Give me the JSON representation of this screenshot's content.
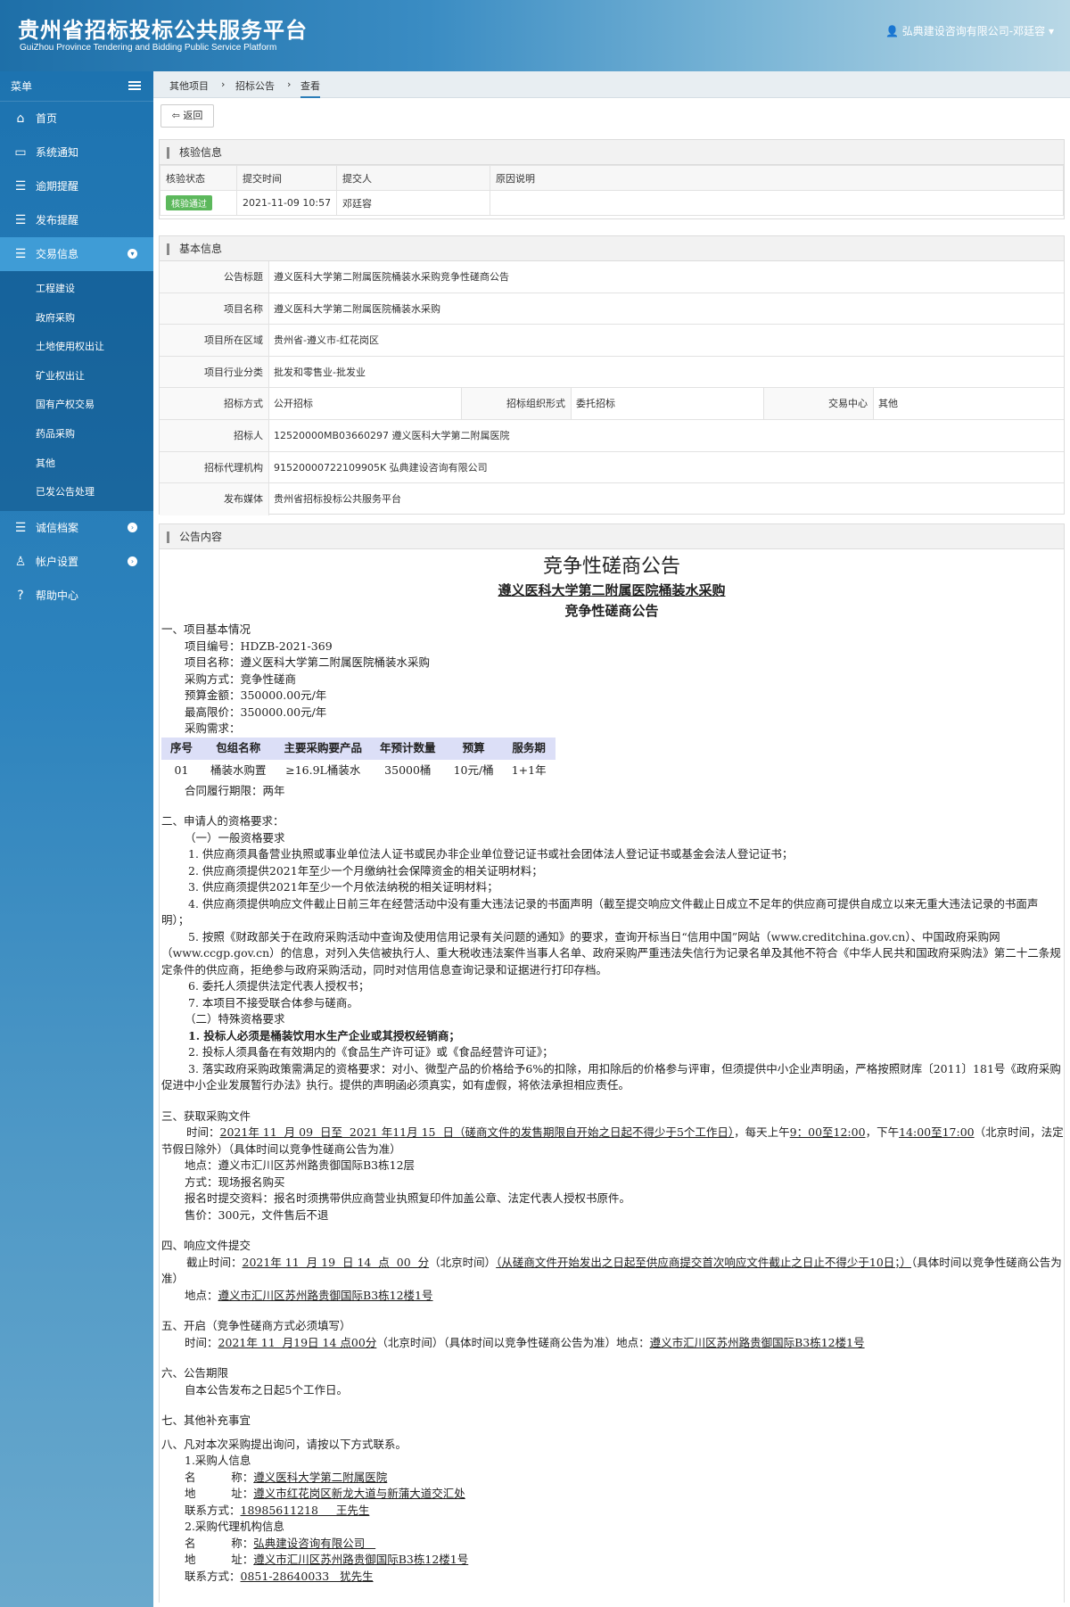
{
  "header": {
    "title": "贵州省招标投标公共服务平台",
    "subtitle": "GuiZhou Province Tendering and Bidding Public Service Platform",
    "user": "弘典建设咨询有限公司-邓廷容"
  },
  "sidebar": {
    "menu_label": "菜单",
    "items": [
      {
        "label": "首页",
        "icon": "home-icon"
      },
      {
        "label": "系统通知",
        "icon": "monitor-icon"
      },
      {
        "label": "逾期提醒",
        "icon": "list-icon"
      },
      {
        "label": "发布提醒",
        "icon": "list-icon"
      },
      {
        "label": "交易信息",
        "icon": "list-icon"
      }
    ],
    "sub_items": [
      "工程建设",
      "政府采购",
      "土地使用权出让",
      "矿业权出让",
      "国有产权交易",
      "药品采购",
      "其他",
      "已发公告处理"
    ],
    "bottom_items": [
      {
        "label": "诚信档案",
        "icon": "list-icon"
      },
      {
        "label": "帐户设置",
        "icon": "user-icon"
      },
      {
        "label": "帮助中心",
        "icon": "help-icon"
      }
    ]
  },
  "breadcrumb": [
    "其他项目",
    "招标公告",
    "查看"
  ],
  "back_label": "返回",
  "verify": {
    "title": "核验信息",
    "headers": [
      "核验状态",
      "提交时间",
      "提交人",
      "原因说明"
    ],
    "status": "核验通过",
    "time": "2021-11-09 10:57",
    "submitter": "邓廷容",
    "reason": ""
  },
  "basic": {
    "title": "基本信息",
    "notice_title_label": "公告标题",
    "notice_title": "遵义医科大学第二附属医院桶装水采购竞争性磋商公告",
    "project_name_label": "项目名称",
    "project_name": "遵义医科大学第二附属医院桶装水采购",
    "region_label": "项目所在区域",
    "region": "贵州省-遵义市-红花岗区",
    "industry_label": "项目行业分类",
    "industry": "批发和零售业-批发业",
    "method_label": "招标方式",
    "method": "公开招标",
    "org_form_label": "招标组织形式",
    "org_form": "委托招标",
    "center_label": "交易中心",
    "center": "其他",
    "tenderer_label": "招标人",
    "tenderer": "12520000MB03660297 遵义医科大学第二附属医院",
    "agency_label": "招标代理机构",
    "agency": "91520000722109905K 弘典建设咨询有限公司",
    "media_label": "发布媒体",
    "media": "贵州省招标投标公共服务平台"
  },
  "notice": {
    "panel_title": "公告内容",
    "title1": "竞争性磋商公告",
    "title2": "遵义医科大学第二附属医院桶装水采购",
    "title3": "竞争性磋商公告",
    "s1": "一、项目基本情况",
    "s1_lines": [
      "项目编号：HDZB-2021-369",
      "项目名称：遵义医科大学第二附属医院桶装水采购",
      "采购方式：竞争性磋商",
      "预算金额：350000.00元/年",
      "最高限价：350000.00元/年",
      "采购需求："
    ],
    "table_headers": [
      "序号",
      "包组名称",
      "主要采购要产品",
      "年预计数量",
      "预算",
      "服务期"
    ],
    "table_row": [
      "01",
      "桶装水购置",
      "≥16.9L桶装水",
      "35000桶",
      "10元/桶",
      "1+1年"
    ],
    "contract_period": "合同履行期限：两年",
    "s2": "二、申请人的资格要求：",
    "s2_general": "（一）一般资格要求",
    "s2_lines": [
      "1. 供应商须具备营业执照或事业单位法人证书或民办非企业单位登记证书或社会团体法人登记证书或基金会法人登记证书；",
      "2. 供应商须提供2021年至少一个月缴纳社会保障资金的相关证明材料；",
      "3. 供应商须提供2021年至少一个月依法纳税的相关证明材料；"
    ],
    "s2_l4": "4. 供应商须提供响应文件截止日前三年在经营活动中没有重大违法记录的书面声明（截至提交响应文件截止日成立不足年的供应商可提供自成立以来无重大违法记录的书面声明）；",
    "s2_l5": "5. 按照《财政部关于在政府采购活动中查询及使用信用记录有关问题的通知》的要求，查询开标当日“信用中国”网站（www.creditchina.gov.cn）、中国政府采购网（www.ccgp.gov.cn）的信息，对列入失信被执行人、重大税收违法案件当事人名单、政府采购严重违法失信行为记录名单及其他不符合《中华人民共和国政府采购法》第二十二条规定条件的供应商，拒绝参与政府采购活动，同时对信用信息查询记录和证据进行打印存档。",
    "s2_l6": "6. 委托人须提供法定代表人授权书；",
    "s2_l7": "7. 本项目不接受联合体参与磋商。",
    "s2_special": "（二）特殊资格要求",
    "s2_sp1": "1. 投标人必须是桶装饮用水生产企业或其授权经销商；",
    "s2_sp2": "2. 投标人须具备在有效期内的《食品生产许可证》或《食品经营许可证》；",
    "s2_sp3": "3. 落实政府采购政策需满足的资格要求：对小、微型产品的价格给予6%的扣除，用扣除后的价格参与评审，但须提供中小企业声明函，严格按照财库〔2011〕181号《政府采购促进中小企业发展暂行办法》执行。提供的声明函必须真实，如有虚假，将依法承担相应责任。",
    "s3": "三、获取采购文件",
    "s3_time_a": "时间：",
    "s3_time_b": "2021年 11  月 09  日至  2021 年11月 15  日（磋商文件的发售期限自开始之日起不得少于5个工作日）",
    "s3_time_c": "，每天上午",
    "s3_time_d": "9：00至12:00",
    "s3_time_e": "，下午",
    "s3_time_f": "14:00至17:00",
    "s3_time_g": "（北京时间，法定节假日除外）（具体时间以竞争性磋商公告为准）",
    "s3_lines": [
      "地点：遵义市汇川区苏州路贵御国际B3栋12层",
      "方式：现场报名购买",
      "报名时提交资料：报名时须携带供应商营业执照复印件加盖公章、法定代表人授权书原件。",
      "售价：300元，文件售后不退"
    ],
    "s4": "四、响应文件提交",
    "s4_a": "截止时间：",
    "s4_b": "2021年 11  月 19  日 14  点  00  分",
    "s4_c": "（北京时间）",
    "s4_d": "（从磋商文件开始发出之日起至供应商提交首次响应文件截止之日止不得少于10日；）",
    "s4_e": "（具体时间以竞争性磋商公告为准）",
    "s4_place_a": "地点：",
    "s4_place_b": "遵义市汇川区苏州路贵御国际B3栋12楼1号",
    "s5": "五、开启（竞争性磋商方式必须填写）",
    "s5_a": "时间：",
    "s5_b": "2021年 11  月19日 14 点00分",
    "s5_c": "（北京时间）（具体时间以竞争性磋商公告为准）地点：",
    "s5_d": "遵义市汇川区苏州路贵御国际B3栋12楼1号",
    "s6": "六、公告期限",
    "s6_line": "自本公告发布之日起5个工作日。",
    "s7": "七、其他补充事宜",
    "s8": "八、凡对本次采购提出询问，请按以下方式联系。",
    "c1": "1.采购人信息",
    "c1_name_a": "名          称：",
    "c1_name_b": "遵义医科大学第二附属医院",
    "c1_addr_a": "地          址：",
    "c1_addr_b": "遵义市红花岗区新龙大道与新蒲大道交汇处",
    "c1_tel_a": "联系方式：",
    "c1_tel_b": "18985611218     王先生",
    "c2": "2.采购代理机构信息",
    "c2_name_a": "名          称：",
    "c2_name_b": "弘典建设咨询有限公司   ",
    "c2_addr_a": "地          址：",
    "c2_addr_b": "遵义市汇川区苏州路贵御国际B3栋12楼1号",
    "c2_tel_a": "联系方式：",
    "c2_tel_b": "0851-28640033   犹先生"
  }
}
